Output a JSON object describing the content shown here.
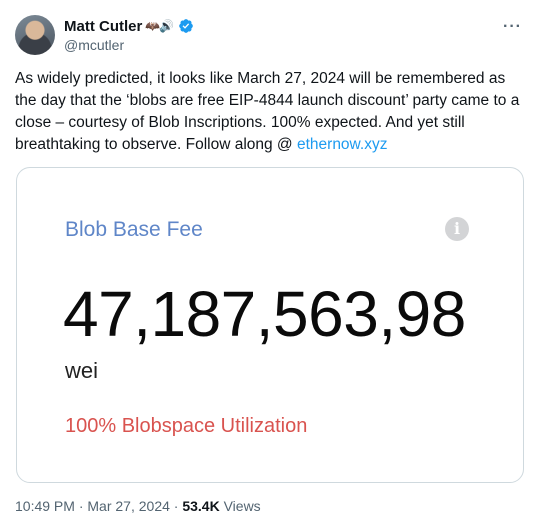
{
  "author": {
    "display_name": "Matt Cutler",
    "name_emoji": "🦇🔊",
    "handle": "@mcutler"
  },
  "more_glyph": "···",
  "tweet": {
    "text": "As widely predicted, it looks like March 27, 2024 will be remembered as the day that the ‘blobs are free EIP-4844 launch discount’ party came to a close – courtesy of Blob Inscriptions. 100% expected. And yet still breathtaking to observe. Follow along @ ",
    "link": "ethernow.xyz"
  },
  "card": {
    "label": "Blob Base Fee",
    "info_glyph": "i",
    "value": "47,187,563,98",
    "unit": "wei",
    "utilization": "100% Blobspace Utilization"
  },
  "meta": {
    "time": "10:49 PM",
    "separator": " · ",
    "date": "Mar 27, 2024",
    "views_count": "53.4K",
    "views_label": " Views"
  },
  "colors": {
    "link": "#1d9bf0",
    "card_label": "#5f86c8",
    "utilization": "#d9534f",
    "verified": "#1d9bf0"
  }
}
